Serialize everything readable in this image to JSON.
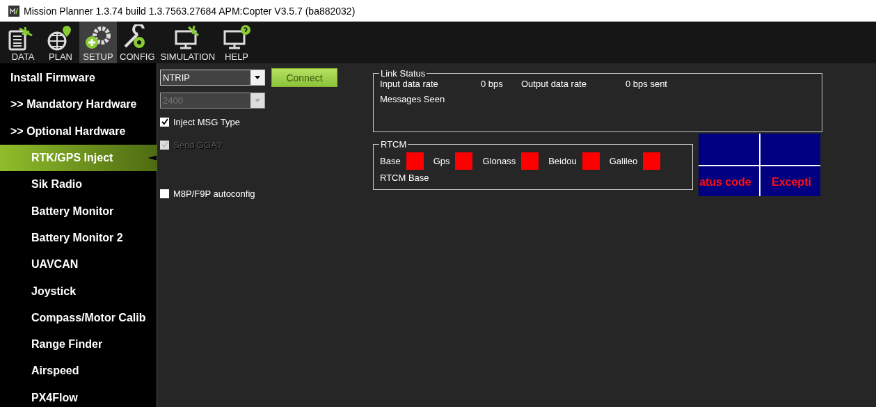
{
  "window": {
    "title": "Mission Planner 1.3.74 build 1.3.7563.27684 APM:Copter V3.5.7 (ba882032)"
  },
  "toolbar": [
    {
      "label": "DATA",
      "kind": "data",
      "selected": false
    },
    {
      "label": "PLAN",
      "kind": "plan",
      "selected": false
    },
    {
      "label": "SETUP",
      "kind": "setup",
      "selected": true
    },
    {
      "label": "CONFIG",
      "kind": "config",
      "selected": false
    },
    {
      "label": "SIMULATION",
      "kind": "simulation",
      "selected": false
    },
    {
      "label": "HELP",
      "kind": "help",
      "selected": false
    }
  ],
  "sidebar": {
    "items": [
      {
        "label": "Install Firmware",
        "selected": false
      },
      {
        "label": ">> Mandatory Hardware",
        "selected": false
      },
      {
        "label": ">> Optional Hardware",
        "selected": false,
        "children": [
          {
            "label": "RTK/GPS Inject",
            "selected": true
          },
          {
            "label": "Sik Radio",
            "selected": false
          },
          {
            "label": "Battery Monitor",
            "selected": false
          },
          {
            "label": "Battery Monitor 2",
            "selected": false
          },
          {
            "label": "UAVCAN",
            "selected": false
          },
          {
            "label": "Joystick",
            "selected": false
          },
          {
            "label": "Compass/Motor Calib",
            "selected": false
          },
          {
            "label": "Range Finder",
            "selected": false
          },
          {
            "label": "Airspeed",
            "selected": false
          },
          {
            "label": "PX4Flow",
            "selected": false
          }
        ]
      }
    ]
  },
  "connection": {
    "type_select": {
      "value": "NTRIP",
      "disabled": false
    },
    "baud_select": {
      "value": "2400",
      "disabled": true
    },
    "connect_button": "Connect"
  },
  "options": [
    {
      "label": "Inject MSG Type",
      "checked": true,
      "disabled": false
    },
    {
      "label": "Send GGA?",
      "checked": true,
      "disabled": true
    },
    {
      "label": "M8P/F9P autoconfig",
      "checked": false,
      "disabled": false
    }
  ],
  "link_status": {
    "title": "Link Status",
    "input_label": "Input data rate",
    "input_value": "0 bps",
    "output_label": "Output data rate",
    "output_value": "0 bps sent",
    "messages_label": "Messages Seen"
  },
  "rtcm": {
    "title": "RTCM",
    "indicators": [
      {
        "label": "Base",
        "color": "#ff0000"
      },
      {
        "label": "Gps",
        "color": "#ff0000"
      },
      {
        "label": "Glonass",
        "color": "#ff0000"
      },
      {
        "label": "Beidou",
        "color": "#ff0000"
      },
      {
        "label": "Galileo",
        "color": "#ff0000"
      }
    ],
    "base_label": "RTCM Base"
  },
  "map": {
    "texts": [
      "atus code",
      "Excepti"
    ]
  }
}
